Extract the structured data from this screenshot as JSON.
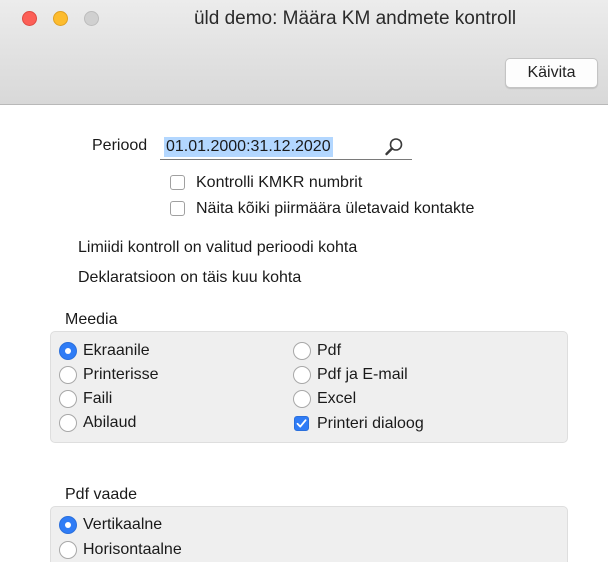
{
  "window": {
    "title": "üld demo: Määra KM andmete kontroll",
    "controls": [
      "close",
      "minimize",
      "maximize"
    ]
  },
  "toolbar": {
    "run_label": "Käivita"
  },
  "period": {
    "label": "Periood",
    "value": "01.01.2000:31.12.2020",
    "icon": "magnifier-icon"
  },
  "options": [
    {
      "label": "Kontrolli KMKR numbrit",
      "checked": false
    },
    {
      "label": "Näita kõiki piirmäära ületavaid kontakte",
      "checked": false
    }
  ],
  "info": {
    "line1": "Limiidi kontroll on valitud perioodi kohta",
    "line2": "Deklaratsioon on täis kuu kohta"
  },
  "media": {
    "title": "Meedia",
    "radios": [
      {
        "label": "Ekraanile",
        "selected": true
      },
      {
        "label": "Printerisse",
        "selected": false
      },
      {
        "label": "Faili",
        "selected": false
      },
      {
        "label": "Abilaud",
        "selected": false
      },
      {
        "label": "Pdf",
        "selected": false
      },
      {
        "label": "Pdf ja E-mail",
        "selected": false
      },
      {
        "label": "Excel",
        "selected": false
      }
    ],
    "printer_dialog": {
      "label": "Printeri dialoog",
      "checked": true
    }
  },
  "pdf_view": {
    "title": "Pdf vaade",
    "radios": [
      {
        "label": "Vertikaalne",
        "selected": true
      },
      {
        "label": "Horisontaalne",
        "selected": false
      }
    ]
  },
  "colors": {
    "accent": "#2f7cf6",
    "selection": "#b3d7ff",
    "close": "#fc5f57",
    "minimize": "#fdbc2e",
    "maximize_disabled": "#d0d0d0"
  }
}
